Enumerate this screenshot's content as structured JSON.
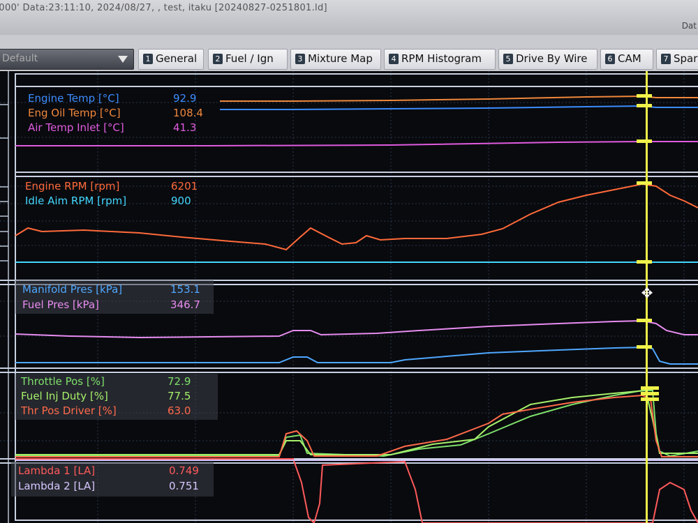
{
  "window": {
    "title": ".000' Data:23:11:10, 2024/08/27,  , test, itaku [20240827-0251801.ld]",
    "title_right": "Dat"
  },
  "toolbar": {
    "preset_label": "Default",
    "tabs": [
      {
        "num": "1",
        "label": "General"
      },
      {
        "num": "2",
        "label": "Fuel / Ign"
      },
      {
        "num": "3",
        "label": "Mixture Map"
      },
      {
        "num": "4",
        "label": "RPM Histogram"
      },
      {
        "num": "5",
        "label": "Drive By Wire"
      },
      {
        "num": "6",
        "label": "CAM"
      },
      {
        "num": "7",
        "label": "Spar"
      }
    ]
  },
  "graphs": {
    "temps": {
      "channels": [
        {
          "name": "Engine Temp [°C]",
          "value": "92.9",
          "color": "#3c8cff"
        },
        {
          "name": "Eng Oil Temp [°C]",
          "value": "108.4",
          "color": "#f0883c"
        },
        {
          "name": "Air Temp Inlet [°C]",
          "value": "41.3",
          "color": "#e05be0"
        }
      ]
    },
    "rpm": {
      "channels": [
        {
          "name": "Engine RPM [rpm]",
          "value": "6201",
          "color": "#ff6a3a"
        },
        {
          "name": "Idle Aim RPM [rpm]",
          "value": "900",
          "color": "#43d7ff"
        }
      ]
    },
    "pressure": {
      "channels": [
        {
          "name": "Manifold Pres [kPa]",
          "value": "153.1",
          "color": "#4fa8ff"
        },
        {
          "name": "Fuel Pres [kPa]",
          "value": "346.7",
          "color": "#e78cf0"
        }
      ]
    },
    "throttle": {
      "channels": [
        {
          "name": "Throttle Pos [%]",
          "value": "72.9",
          "color": "#7ee06a"
        },
        {
          "name": "Fuel Inj Duty [%]",
          "value": "77.5",
          "color": "#a6f06a"
        },
        {
          "name": "Thr Pos Driver [%]",
          "value": "63.0",
          "color": "#ff6a4a"
        }
      ]
    },
    "lambda": {
      "channels": [
        {
          "name": "Lambda 1 [LA]",
          "value": "0.749",
          "color": "#ff5a5a"
        },
        {
          "name": "Lambda 2 [LA]",
          "value": "0.751",
          "color": "#d6c8ff"
        }
      ]
    }
  },
  "colors": {
    "cursor": "#f0f24a",
    "grid": "#2a3a4a",
    "separator": "#cfd6e6"
  },
  "icons": {
    "preset_dropdown": "chevron-down-icon",
    "cursor_move": "move-cursor-icon"
  }
}
